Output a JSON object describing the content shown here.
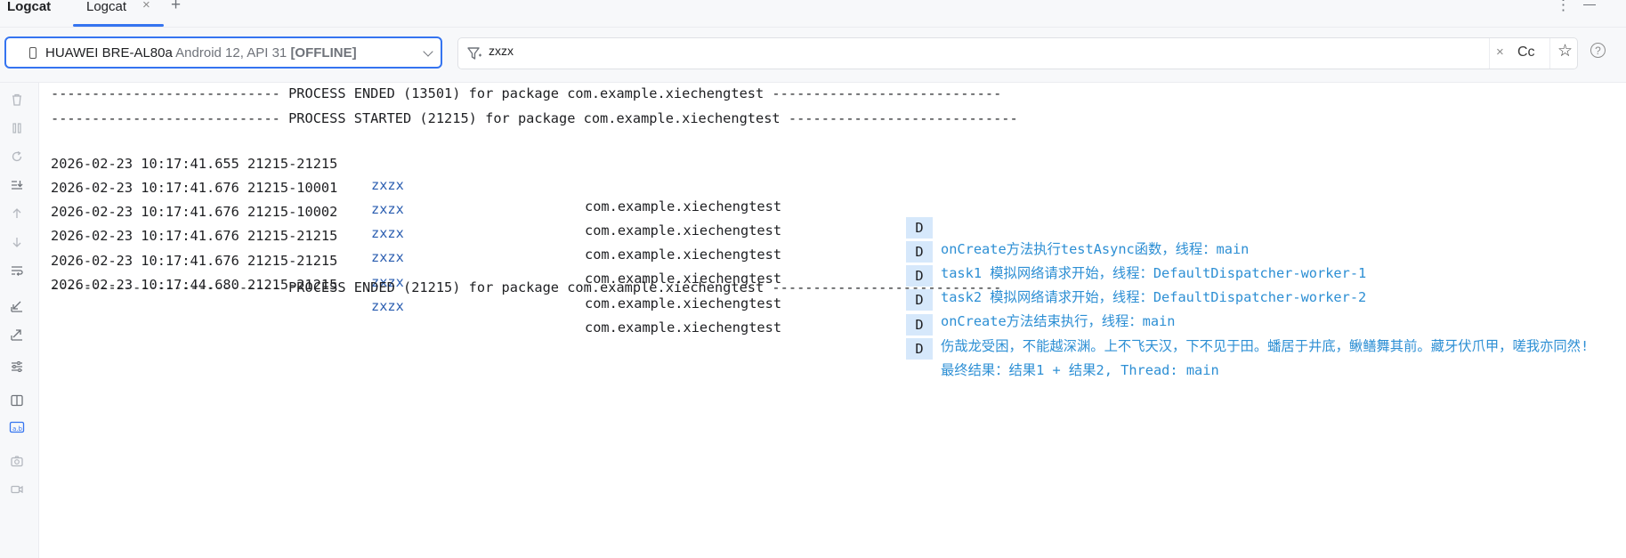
{
  "panel": {
    "title": "Logcat"
  },
  "tabs": [
    {
      "label": "Logcat",
      "close_icon": "×"
    }
  ],
  "toolbar": {
    "add_tab_icon": "+",
    "more_icon": "⋮"
  },
  "device": {
    "name": "HUAWEI BRE-AL80a",
    "api": "Android 12, API 31",
    "status": "[OFFLINE]"
  },
  "search": {
    "value": "zxzx",
    "clear_icon": "×",
    "case_label": "Cc",
    "star_icon": "☆"
  },
  "help_icon": "?",
  "sidebar_icons": [
    "delete-icon",
    "pause-icon",
    "restart-icon",
    "scroll-to-end-icon",
    "up-icon",
    "down-icon",
    "soft-wrap-icon",
    "import-icon",
    "export-icon",
    "settings-icon",
    "split-panels-icon",
    "format-icon",
    "screenshot-icon",
    "screen-record-icon"
  ],
  "log": {
    "header_lines": [
      "---------------------------- PROCESS ENDED (13501) for package com.example.xiechengtest ----------------------------",
      "---------------------------- PROCESS STARTED (21215) for package com.example.xiechengtest ----------------------------"
    ],
    "entries": [
      {
        "timestamp": "2026-02-23 10:17:41.655 21215-21215",
        "tag": "zxzx",
        "package": "com.example.xiechengtest",
        "level": "D",
        "message": "onCreate方法执行testAsync函数，线程：main"
      },
      {
        "timestamp": "2026-02-23 10:17:41.676 21215-10001",
        "tag": "zxzx",
        "package": "com.example.xiechengtest",
        "level": "D",
        "message": "task1 模拟网络请求开始，线程：DefaultDispatcher-worker-1"
      },
      {
        "timestamp": "2026-02-23 10:17:41.676 21215-10002",
        "tag": "zxzx",
        "package": "com.example.xiechengtest",
        "level": "D",
        "message": "task2 模拟网络请求开始，线程：DefaultDispatcher-worker-2"
      },
      {
        "timestamp": "2026-02-23 10:17:41.676 21215-21215",
        "tag": "zxzx",
        "package": "com.example.xiechengtest",
        "level": "D",
        "message": "onCreate方法结束执行，线程：main"
      },
      {
        "timestamp": "2026-02-23 10:17:41.676 21215-21215",
        "tag": "zxzx",
        "package": "com.example.xiechengtest",
        "level": "D",
        "message": "伤哉龙受困，不能越深渊。上不飞天汉，下不见于田。蟠居于井底，鳅鳝舞其前。藏牙伏爪甲，嗟我亦同然!"
      },
      {
        "timestamp": "2026-02-23 10:17:44.680 21215-21215",
        "tag": "zxzx",
        "package": "com.example.xiechengtest",
        "level": "D",
        "message": "最终结果：结果1 + 结果2, Thread: main"
      }
    ],
    "footer_line": "---------------------------- PROCESS ENDED (21215) for package com.example.xiechengtest ----------------------------"
  }
}
